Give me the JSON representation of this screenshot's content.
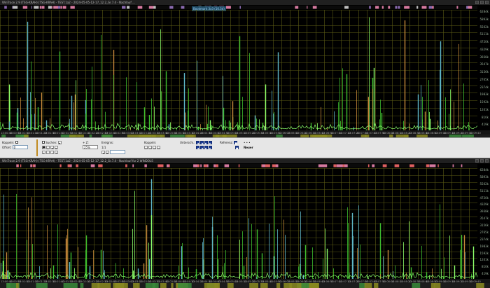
{
  "top_pane": {
    "title": "WinTrace 2.9 (TSG-KRAH) (TSG-KRAH) - TEST.1a2 - 2024-05-05-12-17_12.2_Gr.7.4 - Nachlauf ...",
    "bookmark": "Bookmark 3x3 (10.3d)",
    "y_axis_labels": [
      "6284k",
      "5893k",
      "5502k",
      "5111k",
      "4720k",
      "4329k",
      "3938k",
      "3547k",
      "3156k",
      "2765k",
      "2374k",
      "1983k",
      "1592k",
      "1201k",
      "810k",
      "419k"
    ],
    "status": "1 2 3 4 5 ... 4 5 6 ...",
    "time_ticks": [
      "13:00:40",
      "13:00:50",
      "13:01:00",
      "13:01:10",
      "13:01:20",
      "13:01:30",
      "13:01:40",
      "13:01:50",
      "13:02:00",
      "13:02:10",
      "13:02:20",
      "13:02:30",
      "13:02:40",
      "13:02:50",
      "13:03:00",
      "13:03:10",
      "13:03:20",
      "13:03:30",
      "13:03:40",
      "13:03:50",
      "13:04:00",
      "13:04:10",
      "13:04:20",
      "13:04:30",
      "13:04:40",
      "13:04:50",
      "13:05:00",
      "13:05:10",
      "13:05:20",
      "13:05:30",
      "13:05:40",
      "13:05:50",
      "13:06:00",
      "13:06:10",
      "13:06:20",
      "13:06:30",
      "13:06:40",
      "13:06:50",
      "13:07:00",
      "13:07:10",
      "13:07:20",
      "13:07:30",
      "13:07:40",
      "13:07:50",
      "13:08:00",
      "13:08:10",
      "13:08:20",
      "13:08:30",
      "13:08:40",
      "13:08:50",
      "13:09:00",
      "13:09:10",
      "13:09:20",
      "13:09:30",
      "13:09:40"
    ]
  },
  "toolbar": {
    "kopplung_label": "Koppeln:",
    "kopplung_offset_label": "Offset:",
    "kopplung_value": "0",
    "suchen_label": "Suchen:",
    "zoom_label": "+ Z:",
    "zoom_value": "25%",
    "ereignis_label": "Ereignis:",
    "ereignis_value": "1/1",
    "koppeln2_label": "Koppeln:",
    "unterschied_label": "Unterschi.:",
    "referenz_label": "Referenz:",
    "neuer_label": "Neuer",
    "dots": "• • •",
    "checkbox_a": "A",
    "checkbox_b": "B"
  },
  "bottom_pane": {
    "title": "WinTrace 2.9 (TSG-KRAH) (TSG-KRAH) - TEST.1a2 - 2024-05-05-12-17_12.2_Gr.7.4 - Nachlauf fur 2 WINDOLS",
    "y_axis_labels": [
      "6284k",
      "5893k",
      "5502k",
      "5111k",
      "4720k",
      "4329k",
      "3938k",
      "3547k",
      "3156k",
      "2765k",
      "2374k",
      "1983k",
      "1592k",
      "1201k",
      "810k",
      "419k"
    ],
    "status": "1 2 3 4 5 ... 4 5 6 ..."
  },
  "colors": {
    "plot_bg": "#000000",
    "grid": "#5a5a14",
    "trace_green": "#3fbf2f",
    "trace_bright": "#8cff6a",
    "trace_orange": "#c78a3a",
    "trace_cyan": "#5fb8c8",
    "marker_pink": "#d77aa0",
    "marker_orange": "#e0a050",
    "status_gold": "#8a8a20"
  }
}
